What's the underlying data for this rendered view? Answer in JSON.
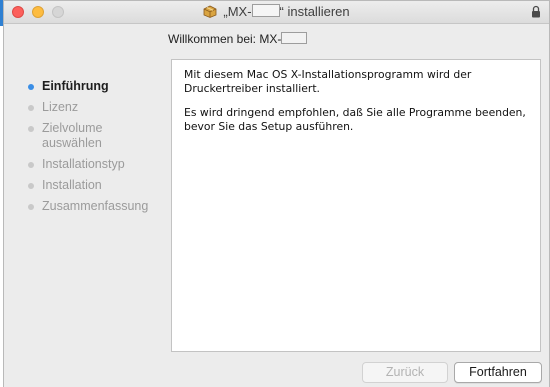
{
  "window": {
    "title_prefix": "„MX-",
    "title_suffix": "“ installieren"
  },
  "welcome": {
    "text": "Willkommen bei: MX-"
  },
  "sidebar": {
    "items": [
      {
        "label": "Einführung",
        "active": true
      },
      {
        "label": "Lizenz",
        "active": false
      },
      {
        "label": "Zielvolume auswählen",
        "active": false
      },
      {
        "label": "Installationstyp",
        "active": false
      },
      {
        "label": "Installation",
        "active": false
      },
      {
        "label": "Zusammenfassung",
        "active": false
      }
    ]
  },
  "content": {
    "paragraph1": "Mit diesem Mac OS X-Installationsprogramm wird der Druckertreiber installiert.",
    "paragraph2": "Es wird dringend empfohlen, daß Sie alle Programme beenden, bevor Sie das Setup ausführen."
  },
  "buttons": {
    "back": "Zurück",
    "continue": "Fortfahren"
  },
  "colors": {
    "accent": "#3a8ee6",
    "close": "#fc605c",
    "minimize": "#fdbc40"
  }
}
